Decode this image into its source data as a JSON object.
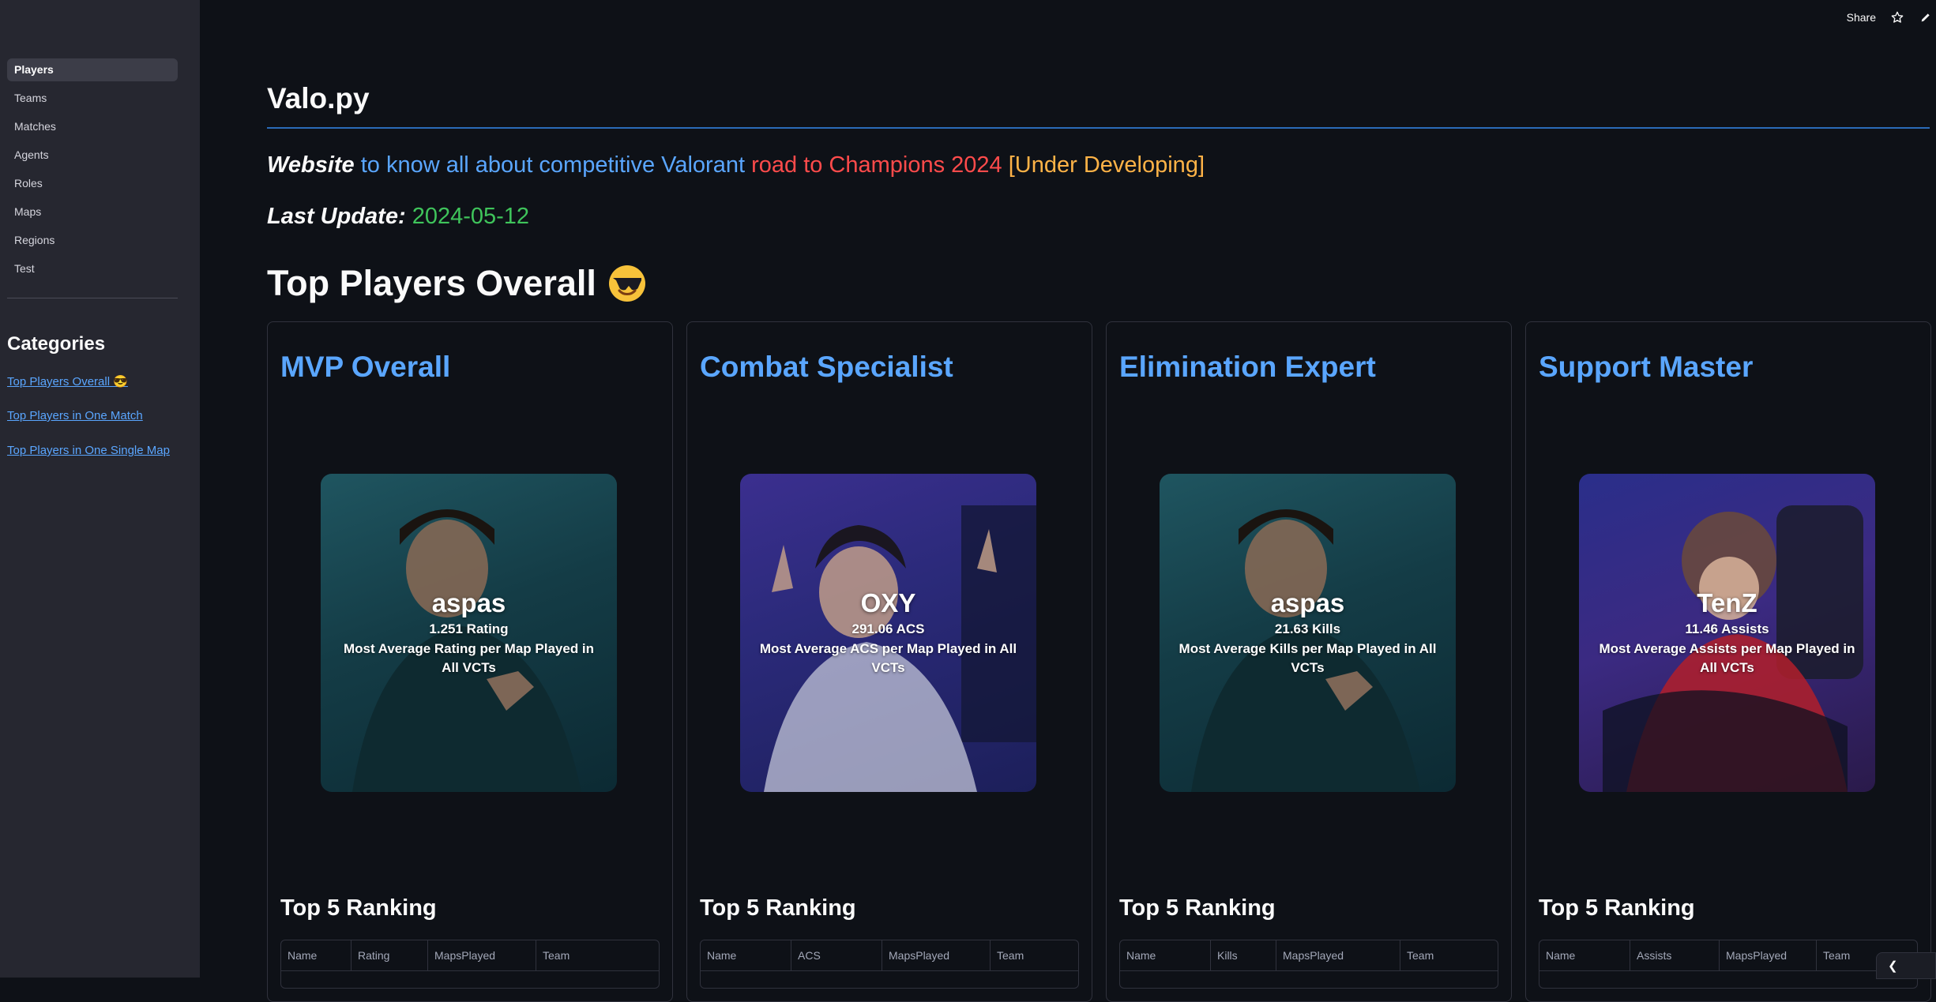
{
  "toolbar": {
    "share_label": "Share"
  },
  "sidebar": {
    "nav": [
      {
        "label": "Players",
        "active": true
      },
      {
        "label": "Teams"
      },
      {
        "label": "Matches"
      },
      {
        "label": "Agents"
      },
      {
        "label": "Roles"
      },
      {
        "label": "Maps"
      },
      {
        "label": "Regions"
      },
      {
        "label": "Test"
      }
    ],
    "categories_title": "Categories",
    "categories": [
      "Top Players Overall 😎",
      "Top Players in One Match",
      "Top Players in One Single Map"
    ]
  },
  "main": {
    "title": "Valo.py",
    "tagline": {
      "part1": "Website",
      "part2": " to know all about competitive Valorant",
      "part3": " road to Champions 2024",
      "part4": " [Under Developing]"
    },
    "last_update_label": "Last Update:",
    "last_update_value": " 2024-05-12",
    "section_title": "Top Players Overall",
    "section_emoji": "😎"
  },
  "cards": [
    {
      "title": "MVP Overall",
      "player": "aspas",
      "stat": "1.251 Rating",
      "desc": "Most Average Rating per Map Played in All VCTs",
      "ranking_title": "Top 5 Ranking",
      "columns": [
        "Name",
        "Rating",
        "MapsPlayed",
        "Team"
      ]
    },
    {
      "title": "Combat Specialist",
      "player": "OXY",
      "stat": "291.06 ACS",
      "desc": "Most Average ACS per Map Played in All VCTs",
      "ranking_title": "Top 5 Ranking",
      "columns": [
        "Name",
        "ACS",
        "MapsPlayed",
        "Team"
      ]
    },
    {
      "title": "Elimination Expert",
      "player": "aspas",
      "stat": "21.63 Kills",
      "desc": "Most Average Kills per Map Played in All VCTs",
      "ranking_title": "Top 5 Ranking",
      "columns": [
        "Name",
        "Kills",
        "MapsPlayed",
        "Team"
      ]
    },
    {
      "title": "Support Master",
      "player": "TenZ",
      "stat": "11.46 Assists",
      "desc": "Most Average Assists per Map Played in All VCTs",
      "ranking_title": "Top 5 Ranking",
      "columns": [
        "Name",
        "Assists",
        "MapsPlayed",
        "Team"
      ]
    }
  ],
  "colors": {
    "background": "#0e1117",
    "sidebar": "#262730",
    "accent_blue": "#5aa6ff",
    "accent_red": "#ff4b4b",
    "accent_orange": "#ffb347",
    "accent_green": "#3fc45b"
  },
  "icons": [
    "star-icon",
    "edit-icon",
    "chevron-left-icon",
    "sunglasses-emoji-icon"
  ]
}
